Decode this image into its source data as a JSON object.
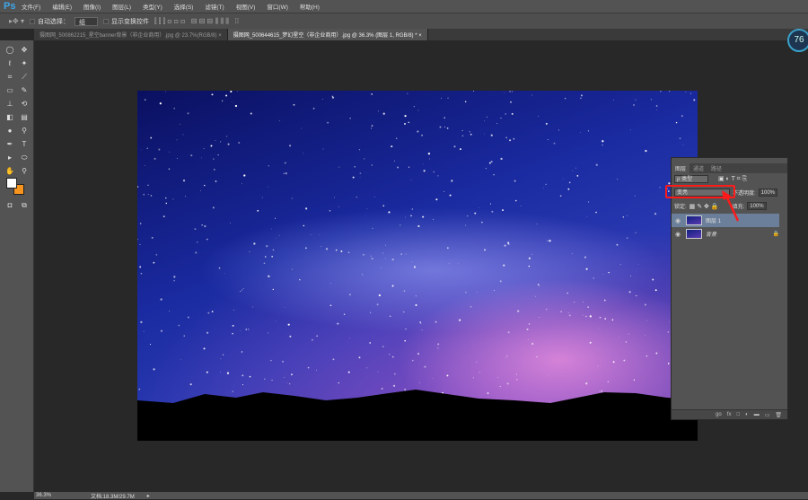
{
  "app": {
    "logo": "Ps"
  },
  "menu": [
    "文件(F)",
    "编辑(E)",
    "图像(I)",
    "图层(L)",
    "类型(Y)",
    "选择(S)",
    "滤镜(T)",
    "视图(V)",
    "窗口(W)",
    "帮助(H)"
  ],
  "options": {
    "auto_select_label": "自动选择：",
    "auto_select_value": "组",
    "show_transform_label": "显示变换控件"
  },
  "tabs": [
    {
      "label": "摄图网_500862215_星空banner背景（非企业商用）.jpg @ 23.7%(RGB/8)",
      "close": "×"
    },
    {
      "label": "摄图网_500644615_梦幻星空（非企业商用）.jpg @ 36.3% (图层 1, RGB/8) *",
      "close": "×"
    }
  ],
  "badge": "76",
  "layers_panel": {
    "tabs": [
      "图层",
      "通道",
      "路径"
    ],
    "filter": "ρ 类型",
    "blend_mode": "变亮",
    "opacity_label": "不透明度:",
    "opacity": "100%",
    "lock_label": "锁定:",
    "fill_label": "填充:",
    "fill": "100%",
    "layers": [
      {
        "name": "图层 1",
        "selected": true
      },
      {
        "name": "背景",
        "locked": true
      }
    ],
    "bottom_icons": [
      "go",
      "fx",
      "□",
      "◐",
      "▬",
      "▭",
      "🗑"
    ]
  },
  "status": {
    "zoom": "36.3%",
    "doc": "文档:18.3M/29.7M"
  },
  "colors": {
    "accent": "#3fa6e8",
    "highlight": "#ff1a1a",
    "foreground": "#ffffff",
    "background": "#f7941d"
  }
}
